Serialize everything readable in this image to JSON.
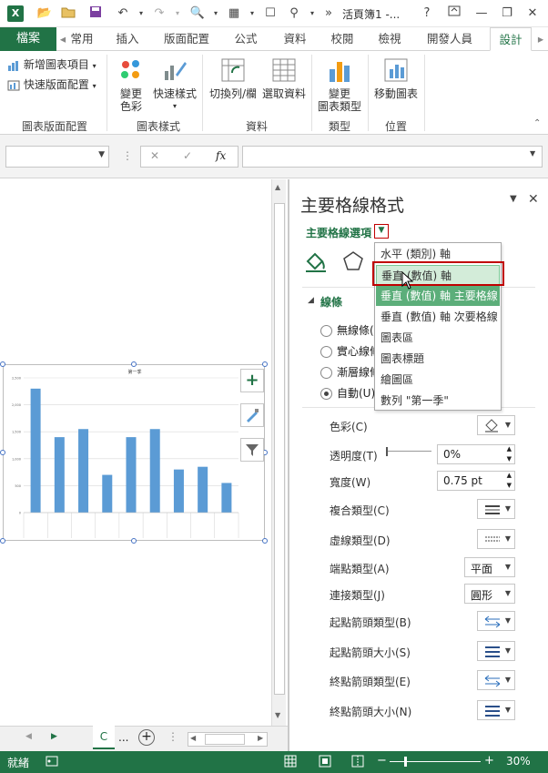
{
  "titlebar": {
    "title": "活頁簿1 -...",
    "help": "?",
    "more": "»"
  },
  "tabs": {
    "file": "檔案",
    "items": [
      "常用",
      "插入",
      "版面配置",
      "公式",
      "資料",
      "校閱",
      "檢視",
      "開發人員",
      "設計"
    ],
    "active_index": 8
  },
  "ribbon": {
    "add_chart_element": "新增圖表項目",
    "quick_layout": "快速版面配置",
    "group_layouts": "圖表版面配置",
    "change_colors_1": "變更",
    "change_colors_2": "色彩",
    "quick_styles": "快速樣式",
    "group_styles": "圖表樣式",
    "switch_row_col": "切換列/欄",
    "select_data": "選取資料",
    "group_data": "資料",
    "change_type_1": "變更",
    "change_type_2": "圖表類型",
    "group_type": "類型",
    "move_chart": "移動圖表",
    "group_location": "位置"
  },
  "formula": {
    "fx": "fx",
    "cancel": "✕",
    "enter": "✓",
    "name_value": "",
    "formula_value": ""
  },
  "chart": {
    "title": "第一季",
    "y_ticks": [
      "2,500",
      "2,000",
      "1,500",
      "1,000",
      "500",
      "0"
    ],
    "bars": [
      2.3,
      1.4,
      1.55,
      0.7,
      1.4,
      1.55,
      0.8,
      0.85,
      0.55
    ],
    "ymax": 2.5,
    "bar_color": "#5b9bd5"
  },
  "sheettabs": {
    "current": "C",
    "more": "...",
    "add": "+"
  },
  "status": {
    "ready": "就緒",
    "zoom": "30%"
  },
  "pane": {
    "title": "主要格線格式",
    "options_label": "主要格線選項",
    "section_line": "線條",
    "radio_none": "無線條(",
    "radio_solid": "實心線條",
    "radio_gradient": "漸層線條",
    "radio_auto": "自動(U)",
    "props": [
      {
        "label": "色彩(C)"
      },
      {
        "label": "透明度(T)",
        "value": "0%"
      },
      {
        "label": "寬度(W)",
        "value": "0.75 pt"
      },
      {
        "label": "複合類型(C)"
      },
      {
        "label": "虛線類型(D)"
      },
      {
        "label": "端點類型(A)",
        "value": "平面"
      },
      {
        "label": "連接類型(J)",
        "value": "圓形"
      },
      {
        "label": "起點箭頭類型(B)"
      },
      {
        "label": "起點箭頭大小(S)"
      },
      {
        "label": "終點箭頭類型(E)"
      },
      {
        "label": "終點箭頭大小(N)"
      }
    ]
  },
  "dropdown": {
    "items": [
      "水平 (類別) 軸",
      "垂直 (數值) 軸",
      "垂直 (數值) 軸 主要格線",
      "垂直 (數值) 軸 次要格線",
      "圖表區",
      "圖表標題",
      "繪圖區",
      "數列 \"第一季\""
    ],
    "hover_index": 1,
    "selected_index": 2
  },
  "colors": {
    "excel_green": "#217346",
    "highlight_red": "#c00000"
  }
}
